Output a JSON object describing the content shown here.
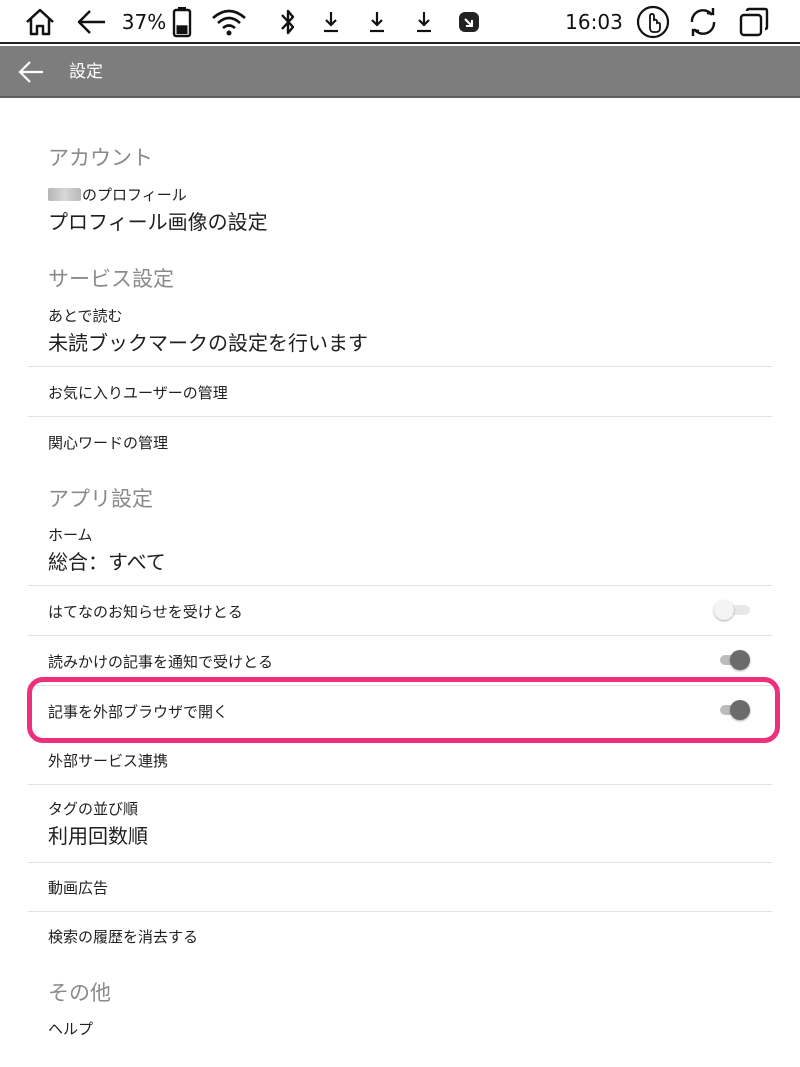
{
  "status_bar": {
    "battery_percent": "37%",
    "battery_level": 0.37,
    "time": "16:03",
    "icons": [
      "home-icon",
      "back-arrow-icon",
      "battery-icon",
      "wifi-icon",
      "bluetooth-icon",
      "download-icon",
      "download-icon",
      "download-icon",
      "app-notification-icon",
      "touch-icon",
      "sync-icon",
      "recent-apps-icon"
    ]
  },
  "app_bar": {
    "title": "設定",
    "background": "#7d7d7d"
  },
  "sections": {
    "account": {
      "header": "アカウント",
      "profile": {
        "title": "のプロフィール",
        "value": "プロフィール画像の設定"
      }
    },
    "service": {
      "header": "サービス設定",
      "read_later": {
        "title": "あとで読む",
        "value": "未読ブックマークの設定を行います"
      },
      "favorite_users": "お気に入りユーザーの管理",
      "interest_words": "関心ワードの管理"
    },
    "app": {
      "header": "アプリ設定",
      "home": {
        "title": "ホーム",
        "value": "総合：すべて"
      },
      "hatena_notice": {
        "label": "はてなのお知らせを受けとる",
        "enabled": false
      },
      "reading_notify": {
        "label": "読みかけの記事を通知で受けとる",
        "enabled": true
      },
      "external_browser": {
        "label": "記事を外部ブラウザで開く",
        "enabled": true
      },
      "external_services": "外部サービス連携",
      "tag_order": {
        "title": "タグの並び順",
        "value": "利用回数順"
      },
      "video_ads": "動画広告",
      "clear_history": "検索の履歴を消去する"
    },
    "other": {
      "header": "その他",
      "help": "ヘルプ"
    }
  },
  "colors": {
    "highlight": "#ee2f7c",
    "section_header": "#8a8a8a",
    "switch_on_thumb": "#6b6b6b"
  }
}
